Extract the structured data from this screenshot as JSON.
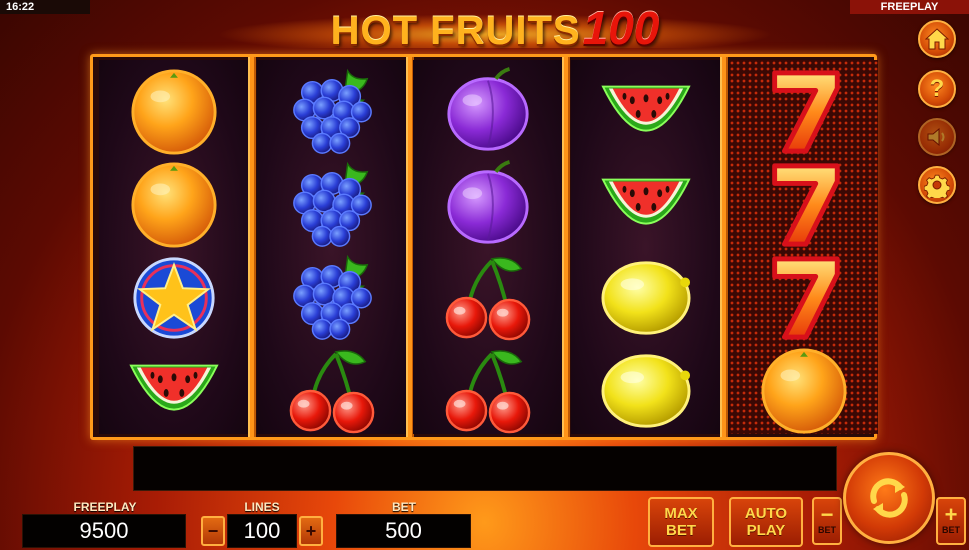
{
  "status": {
    "clock": "16:22",
    "mode": "FREEPLAY"
  },
  "logo": {
    "title": "HOT FRUITS",
    "number": "100"
  },
  "reels": [
    [
      "orange",
      "orange",
      "star",
      "watermelon"
    ],
    [
      "grapes",
      "grapes",
      "grapes",
      "cherries"
    ],
    [
      "plum",
      "plum",
      "cherries",
      "cherries"
    ],
    [
      "watermelon",
      "watermelon",
      "lemon",
      "lemon"
    ],
    [
      "seven",
      "seven",
      "seven",
      "orange"
    ]
  ],
  "side_menu": [
    {
      "icon": "home-icon",
      "enabled": true
    },
    {
      "icon": "help-icon",
      "enabled": true
    },
    {
      "icon": "sound-icon",
      "enabled": false
    },
    {
      "icon": "gear-icon",
      "enabled": true
    }
  ],
  "panel": {
    "freeplay_label": "FREEPLAY",
    "freeplay_value": "9500",
    "lines_label": "LINES",
    "lines_value": "100",
    "lines_minus": "−",
    "lines_plus": "+",
    "bet_label": "BET",
    "bet_value": "500",
    "max_bet_line1": "MAX",
    "max_bet_line2": "BET",
    "auto_play_line1": "AUTO",
    "auto_play_line2": "PLAY",
    "bet_minus_symbol": "−",
    "bet_minus_label": "BET",
    "bet_plus_symbol": "+",
    "bet_plus_label": "BET"
  },
  "colors": {
    "accent": "#ff9a1a",
    "button_gold_text": "#ffd84a",
    "logo_red": "#e8150a"
  }
}
